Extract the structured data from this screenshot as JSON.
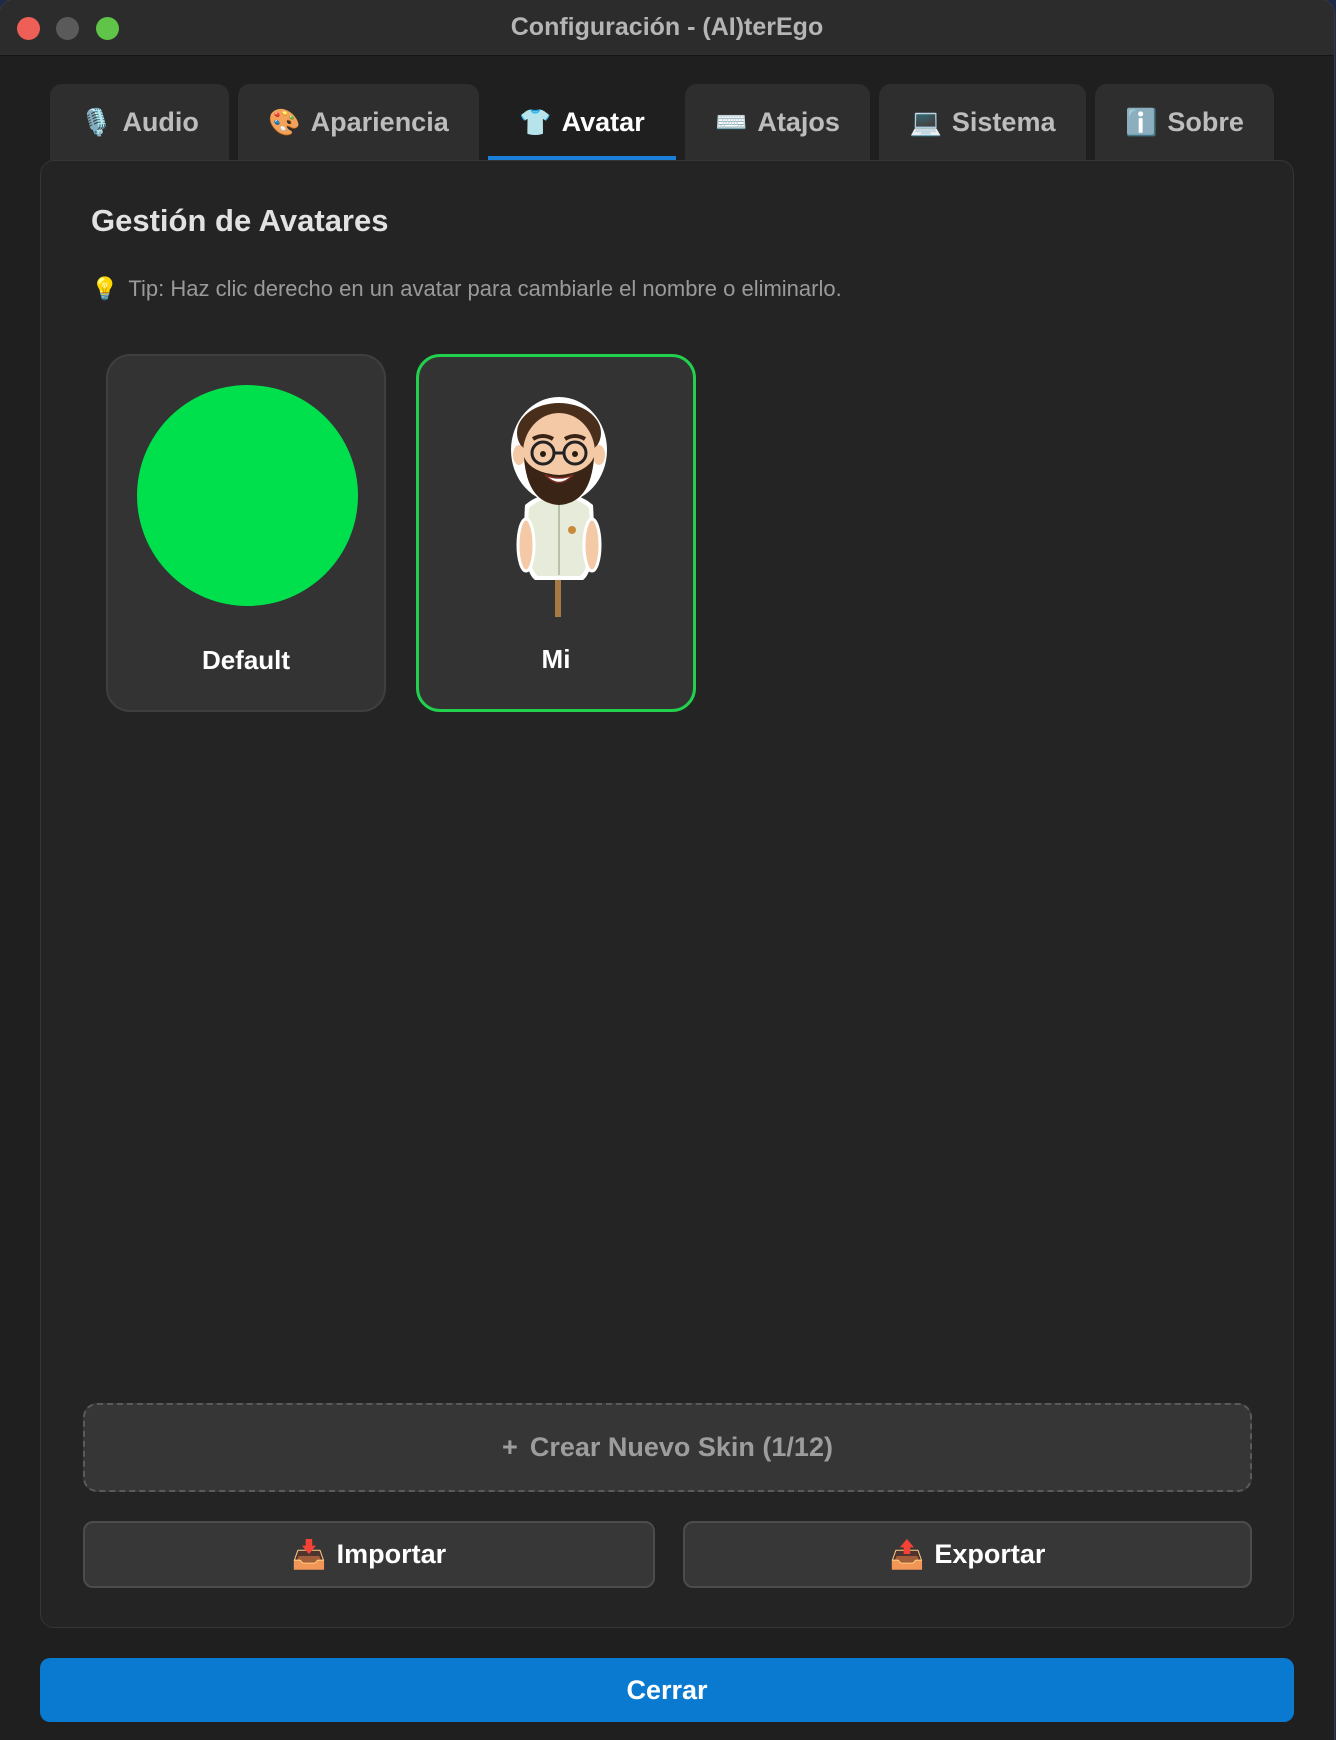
{
  "window": {
    "title": "Configuración - (AI)terEgo"
  },
  "tabs": [
    {
      "icon": "🎙️",
      "label": "Audio",
      "active": false
    },
    {
      "icon": "🎨",
      "label": "Apariencia",
      "active": false
    },
    {
      "icon": "👕",
      "label": "Avatar",
      "active": true
    },
    {
      "icon": "⌨️",
      "label": "Atajos",
      "active": false
    },
    {
      "icon": "💻",
      "label": "Sistema",
      "active": false
    },
    {
      "icon": "ℹ️",
      "label": "Sobre",
      "active": false
    }
  ],
  "avatar_panel": {
    "title": "Gestión de Avatares",
    "tip_icon": "💡",
    "tip": "Tip: Haz clic derecho en un avatar para cambiarle el nombre o eliminarlo.",
    "avatars": [
      {
        "name": "Default",
        "preview": "green-circle",
        "selected": false
      },
      {
        "name": "Mi",
        "preview": "bearded-man-figure",
        "selected": true
      }
    ],
    "create_button": {
      "icon": "+",
      "label": "Crear Nuevo Skin (1/12)"
    },
    "import_button": {
      "icon": "📥",
      "label": "Importar"
    },
    "export_button": {
      "icon": "📤",
      "label": "Exportar"
    }
  },
  "footer": {
    "close_label": "Cerrar"
  },
  "colors": {
    "accent": "#0a79d0",
    "selected_border": "#22d04e",
    "default_avatar": "#00e04c"
  }
}
